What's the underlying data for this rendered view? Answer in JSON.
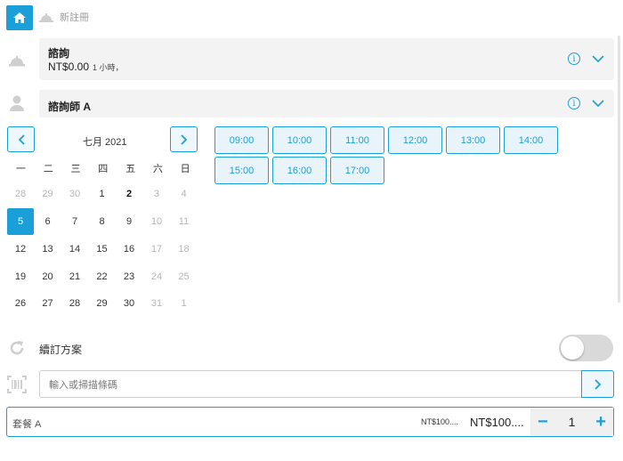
{
  "breadcrumb": {
    "current": "新註冊",
    "icons": {
      "home": "home-icon",
      "bell": "service-bell-icon"
    }
  },
  "service": {
    "title": "諮詢",
    "price": "NT$0.00",
    "duration": "1 小時，"
  },
  "staff": {
    "name": "諮詢師 A"
  },
  "calendar": {
    "month": "七月 2021",
    "weekdays": [
      "一",
      "二",
      "三",
      "四",
      "五",
      "六",
      "日"
    ],
    "weeks": [
      [
        {
          "d": "28",
          "muted": true
        },
        {
          "d": "29",
          "muted": true
        },
        {
          "d": "30",
          "muted": true
        },
        {
          "d": "1"
        },
        {
          "d": "2",
          "bold": true
        },
        {
          "d": "3",
          "muted": true
        },
        {
          "d": "4",
          "muted": true
        }
      ],
      [
        {
          "d": "5",
          "selected": true
        },
        {
          "d": "6"
        },
        {
          "d": "7"
        },
        {
          "d": "8"
        },
        {
          "d": "9"
        },
        {
          "d": "10",
          "muted": true
        },
        {
          "d": "11",
          "muted": true
        }
      ],
      [
        {
          "d": "12"
        },
        {
          "d": "13"
        },
        {
          "d": "14"
        },
        {
          "d": "15"
        },
        {
          "d": "16"
        },
        {
          "d": "17",
          "muted": true
        },
        {
          "d": "18",
          "muted": true
        }
      ],
      [
        {
          "d": "19"
        },
        {
          "d": "20"
        },
        {
          "d": "21"
        },
        {
          "d": "22"
        },
        {
          "d": "23"
        },
        {
          "d": "24",
          "muted": true
        },
        {
          "d": "25",
          "muted": true
        }
      ],
      [
        {
          "d": "26"
        },
        {
          "d": "27"
        },
        {
          "d": "28"
        },
        {
          "d": "29"
        },
        {
          "d": "30"
        },
        {
          "d": "31",
          "muted": true
        },
        {
          "d": "1",
          "muted": true
        }
      ]
    ]
  },
  "time_slots": [
    "09:00",
    "10:00",
    "11:00",
    "12:00",
    "13:00",
    "14:00",
    "15:00",
    "16:00",
    "17:00"
  ],
  "renewal": {
    "label": "續訂方案",
    "enabled": false
  },
  "scan": {
    "placeholder": "輸入或掃描條碼"
  },
  "package_item": {
    "name": "套餐 A",
    "unit_price": "NT$100....",
    "total": "NT$100....",
    "quantity": "1",
    "minus": "−",
    "plus": "+"
  },
  "colors": {
    "accent": "#1a9fd9",
    "panel": "#f3f3f3"
  }
}
